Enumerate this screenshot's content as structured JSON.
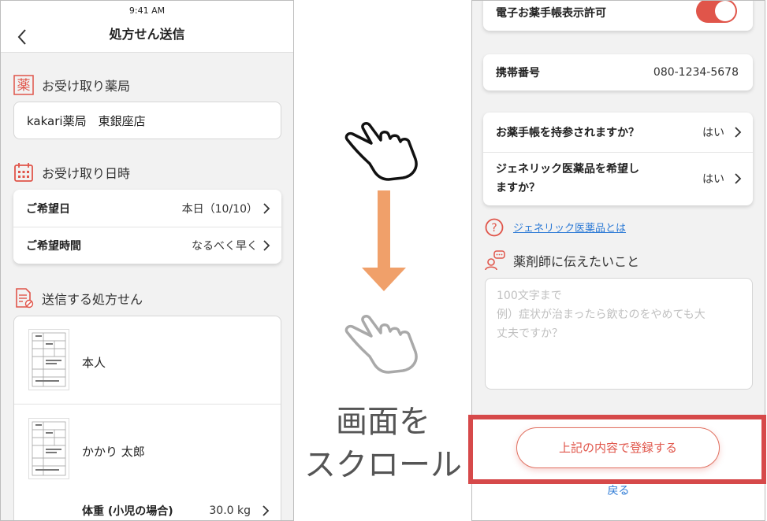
{
  "status_bar": {
    "time": "9:41 AM"
  },
  "left": {
    "nav_title": "処方せん送信",
    "pharmacy_section": {
      "icon_char": "薬",
      "label": "お受け取り薬局",
      "value": "kakari薬局　東銀座店"
    },
    "datetime_section": {
      "label": "お受け取り日時",
      "rows": [
        {
          "label": "ご希望日",
          "value": "本日（10/10）"
        },
        {
          "label": "ご希望時間",
          "value": "なるべく早く"
        }
      ]
    },
    "prescription_section": {
      "label": "送信する処方せん",
      "items": [
        {
          "name": "本人"
        },
        {
          "name": "かかり 太郎"
        }
      ],
      "weight_row": {
        "label": "体重 (小児の場合)",
        "value": "30.0 kg"
      }
    }
  },
  "middle": {
    "caption_line1": "画面を",
    "caption_line2": "スクロール"
  },
  "right": {
    "permission_row": {
      "label": "電子お薬手帳表示許可",
      "enabled": true
    },
    "phone_row": {
      "label": "携帯番号",
      "value": "080-1234-5678"
    },
    "question_rows": [
      {
        "label": "お薬手帳を持参されますか？",
        "value": "はい"
      },
      {
        "label_line1": "ジェネリック医薬品を希望し",
        "label_line2": "ますか？",
        "value": "はい"
      }
    ],
    "generic_link": "ジェネリック医薬品とは",
    "message_section": {
      "label": "薬剤師に伝えたいこと",
      "placeholder_line1": "100文字まで",
      "placeholder_line2": "例）症状が治まったら飲むのをやめても大",
      "placeholder_line3": "丈夫ですか？"
    },
    "submit_label": "上記の内容で登録する",
    "back_label": "戻る"
  },
  "colors": {
    "accent": "#e0554a",
    "link": "#2e7bd6",
    "arrow": "#f0a06a",
    "highlight": "#d6494a"
  }
}
